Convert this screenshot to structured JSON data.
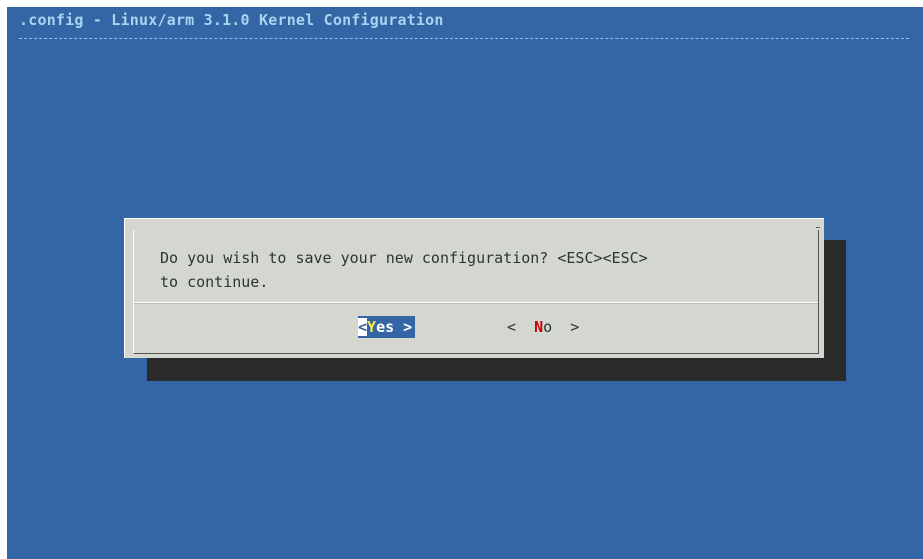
{
  "window": {
    "title": ".config - Linux/arm 3.1.0 Kernel Configuration"
  },
  "dialog": {
    "message": "Do you wish to save your new configuration? <ESC><ESC>\nto continue.",
    "buttons": {
      "yes": {
        "bracket_left": "<",
        "hotkey": "Y",
        "rest": "es",
        "bracket_right": ">"
      },
      "no": {
        "bracket_left": "<",
        "hotkey": "N",
        "rest": "o",
        "bracket_right": ">"
      }
    },
    "selected_button": "yes"
  },
  "colors": {
    "background": "#3465a4",
    "dialog": "#d3d7cf",
    "shadow": "#2a2a2a",
    "title_text": "#a8d4f0",
    "highlight_text": "#ffffff",
    "hotkey_selected": "#fce94f",
    "hotkey_unselected": "#cc0000"
  }
}
